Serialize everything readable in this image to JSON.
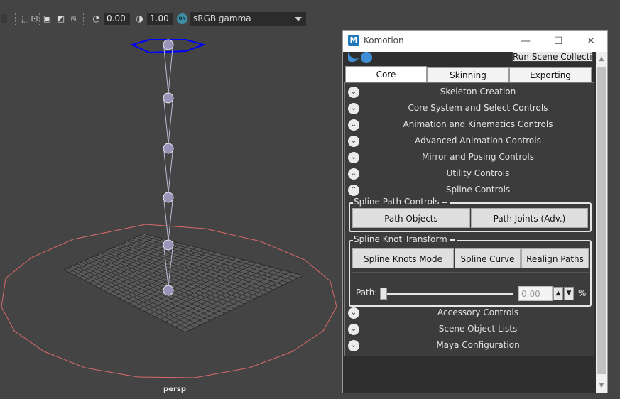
{
  "toolbar": {
    "exposure_value": "0.00",
    "gamma_value": "1.00",
    "color_management_icon_label": "ON",
    "color_space": "sRGB gamma"
  },
  "viewport": {
    "camera_label": "persp"
  },
  "komotion": {
    "title": "Komotion",
    "run_scene_button": "Run Scene Collection",
    "tabs": [
      {
        "label": "Core",
        "active": true
      },
      {
        "label": "Skinning",
        "active": false
      },
      {
        "label": "Exporting",
        "active": false
      }
    ],
    "sections_top": [
      {
        "label": "Skeleton Creation",
        "state": "collapsed"
      },
      {
        "label": "Core System and Select Controls",
        "state": "collapsed"
      },
      {
        "label": "Animation and Kinematics Controls",
        "state": "collapsed"
      },
      {
        "label": "Advanced Animation Controls",
        "state": "collapsed"
      },
      {
        "label": "Mirror and Posing Controls",
        "state": "collapsed"
      },
      {
        "label": "Utility Controls",
        "state": "collapsed"
      },
      {
        "label": "Spline Controls",
        "state": "expanded"
      }
    ],
    "spline_path_controls": {
      "title": "Spline Path Controls",
      "buttons": [
        "Path Objects",
        "Path Joints (Adv.)"
      ]
    },
    "spline_knot_transform": {
      "title": "Spline Knot Transform",
      "buttons": [
        "Spline Knots Mode",
        "Spline Curve",
        "Realign Paths"
      ],
      "path_label": "Path:",
      "path_value": "0.00",
      "path_fraction": 0,
      "unit": "%"
    },
    "sections_bottom": [
      {
        "label": "Accessory Controls",
        "state": "collapsed"
      },
      {
        "label": "Scene Object Lists",
        "state": "collapsed"
      },
      {
        "label": "Maya Configuration",
        "state": "collapsed"
      }
    ]
  },
  "colors": {
    "viewport_bg": "#444444",
    "selected_control": "#0000ff",
    "circle_control": "#d86a6a",
    "panel_bg": "#3c3c3c"
  }
}
